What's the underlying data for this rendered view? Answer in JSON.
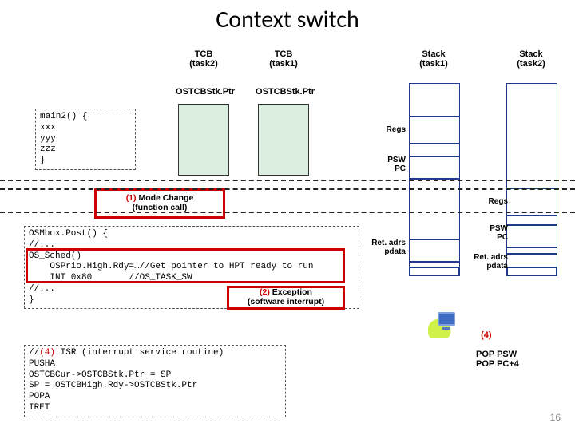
{
  "title": "Context switch",
  "headers": {
    "tcb2": "TCB\n(task2)",
    "tcb1": "TCB\n(task1)",
    "stack1": "Stack\n(task1)",
    "stack2": "Stack\n(task2)"
  },
  "ptr": {
    "tcb2": "OSTCBStk.Ptr",
    "tcb1": "OSTCBStk.Ptr"
  },
  "stack1_labels": {
    "regs": "Regs",
    "psw_pc": "PSW\nPC",
    "ret": "Ret. adrs\npdata"
  },
  "stack2_labels": {
    "regs": "Regs",
    "psw_pc": "PSW\nPC",
    "ret": "Ret. adrs\npdata"
  },
  "code": {
    "main2": "main2() {\nxxx\nyyy\nzzz\n}",
    "mbox": "OSMbox.Post() {\n//...\nOS_Sched()\n    OSPrio.High.Rdy=…//Get pointer to HPT ready to run\n    INT 0x80       //OS_TASK_SW\n//...\n}",
    "isr": "//(4) ISR (interrupt service routine)\nPUSHA\nOSTCBCur->OSTCBStk.Ptr = SP\nSP = OSTCBHigh.Rdy->OSTCBStk.Ptr\nPOPA\nIRET"
  },
  "steps": {
    "s1": "(1) Mode Change\n(function call)",
    "s2": "(2) Exception\n(software interrupt)",
    "s4": "(4)\nPOP PSW\nPOP PC+4"
  },
  "step_markers": {
    "s4_inline": "(4)"
  },
  "slide_number": "16"
}
